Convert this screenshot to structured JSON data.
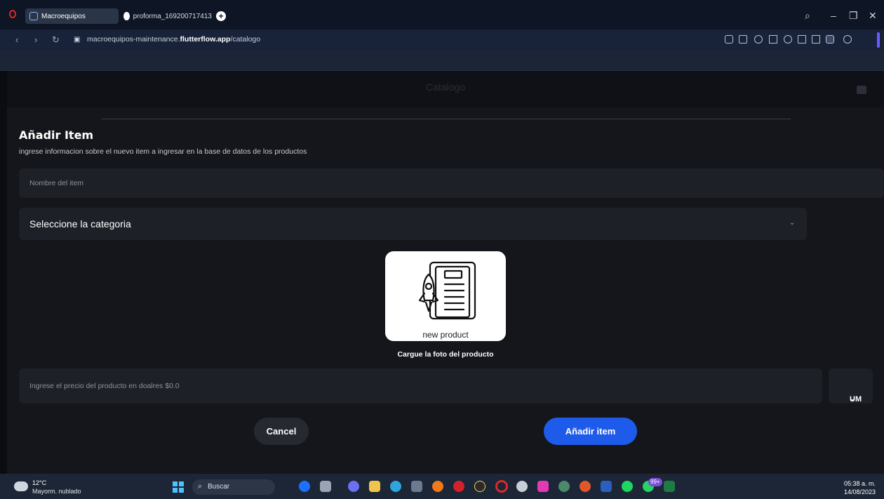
{
  "browser": {
    "tabs": [
      {
        "label": "Macroequipos",
        "active": true
      },
      {
        "label": "proforma_169200717413",
        "active": false
      }
    ],
    "url_prefix": "macroequipos-maintenance.",
    "url_domain": "flutterflow.app",
    "url_path": "/catalogo",
    "window_controls": [
      "search",
      "minimize",
      "restore",
      "close"
    ]
  },
  "app": {
    "title": "Catalogo"
  },
  "form": {
    "title": "Añadir Item",
    "subtitle": "ingrese informacion  sobre el nuevo item a ingresar en la base de datos de los productos",
    "name_placeholder": "Nombre del item",
    "category_placeholder": "Seleccione la categoria",
    "image_caption": "new product",
    "upload_label": "Cargue la foto del producto",
    "price_placeholder": "Ingrese el precio del producto  en doalres $0.0",
    "unit_label": "UM",
    "cancel_label": "Cancel",
    "submit_label": "Añadir item"
  },
  "taskbar": {
    "weather_temp": "12°C",
    "weather_desc": "Mayorm. nublado",
    "search_label": "Buscar",
    "time": "05:38 a. m.",
    "date": "14/08/2023",
    "badge": "99+"
  },
  "colors": {
    "accent": "#1f5bea",
    "field_bg": "#1d2027",
    "page_bg": "#14161b"
  }
}
